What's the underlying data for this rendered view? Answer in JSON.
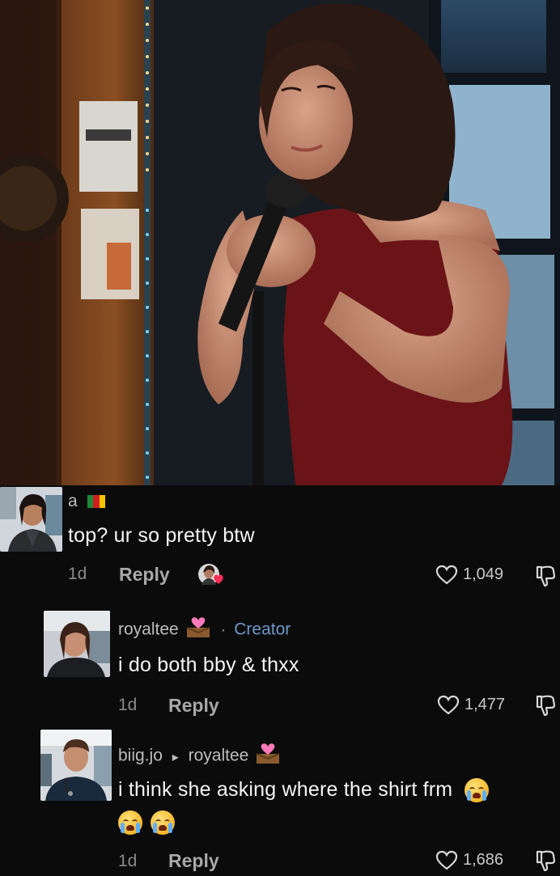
{
  "photo": {
    "description_icon": "performer-photo"
  },
  "comments": [
    {
      "username": "a",
      "badge_icon": "flag-icon",
      "text": "top? ur so pretty btw",
      "time": "1d",
      "reply_label": "Reply",
      "likes": "1,049"
    },
    {
      "username": "royaltee",
      "badge_icon": "heart-box-emoji",
      "separator": "·",
      "role": "Creator",
      "text": "i do both bby & thxx",
      "time": "1d",
      "reply_label": "Reply",
      "likes": "1,477"
    },
    {
      "username": "biig.jo",
      "reply_to_arrow": "▸",
      "reply_to": "royaltee",
      "text": "i think she asking where the shirt frm",
      "time": "1d",
      "reply_label": "Reply",
      "likes": "1,686"
    }
  ]
}
